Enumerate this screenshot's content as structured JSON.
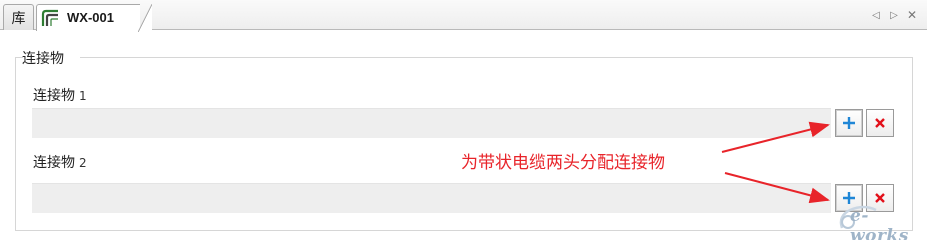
{
  "tabs": [
    {
      "label": "库",
      "active": false
    },
    {
      "label": "WX-001",
      "active": true
    }
  ],
  "tab_nav": {
    "prev": "◁",
    "next": "▷",
    "close": "✕"
  },
  "group": {
    "title": "连接物",
    "connectors": [
      {
        "label": "连接物",
        "index": "1",
        "value": ""
      },
      {
        "label": "连接物",
        "index": "2",
        "value": ""
      }
    ]
  },
  "buttons": {
    "add_icon": "plus-icon",
    "remove_icon": "close-icon"
  },
  "annotation": {
    "text": "为带状电缆两头分配连接物",
    "color": "#e8242a"
  },
  "watermark": {
    "text": "e-works"
  },
  "colors": {
    "accent_blue": "#1f86d6",
    "delete_red": "#e2101a",
    "field_bg": "#eeeeee"
  }
}
